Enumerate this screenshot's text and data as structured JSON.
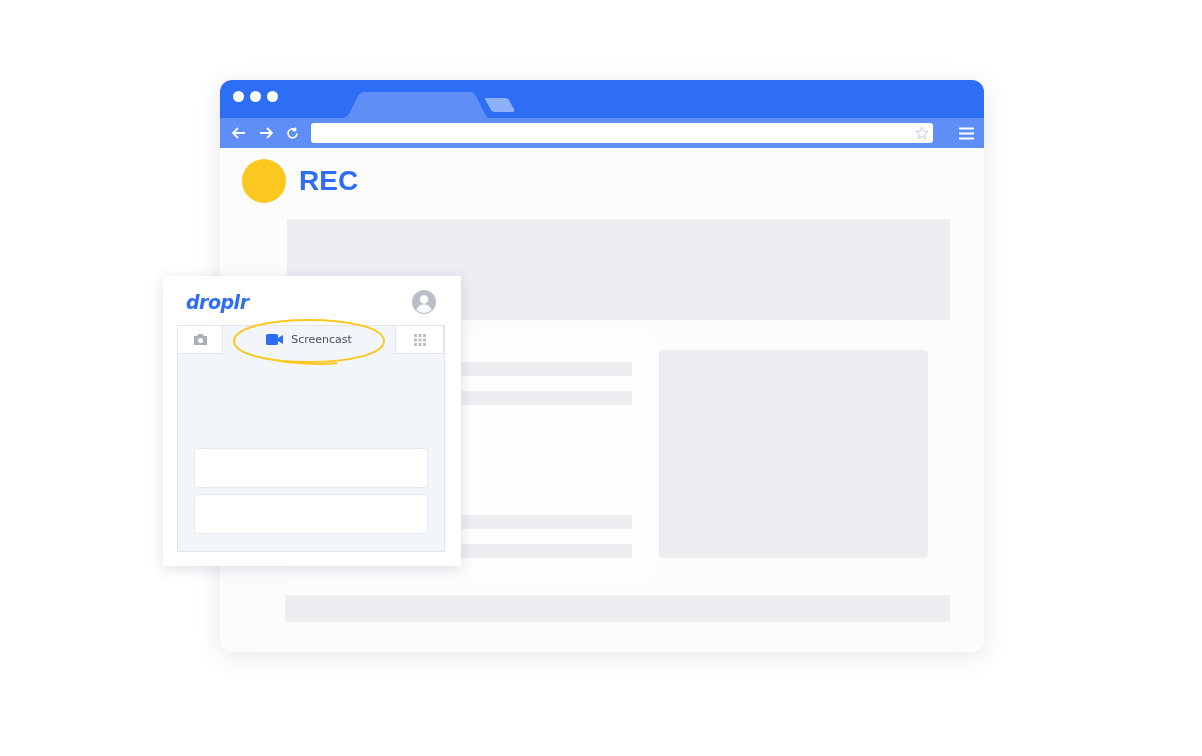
{
  "browser": {
    "page": {
      "heading": "REC"
    }
  },
  "popup": {
    "logo": "droplr",
    "tabs": [
      {
        "kind": "camera",
        "selected": false
      },
      {
        "kind": "screencast",
        "label": "Screencast",
        "selected": true
      },
      {
        "kind": "apps",
        "selected": false
      }
    ]
  }
}
